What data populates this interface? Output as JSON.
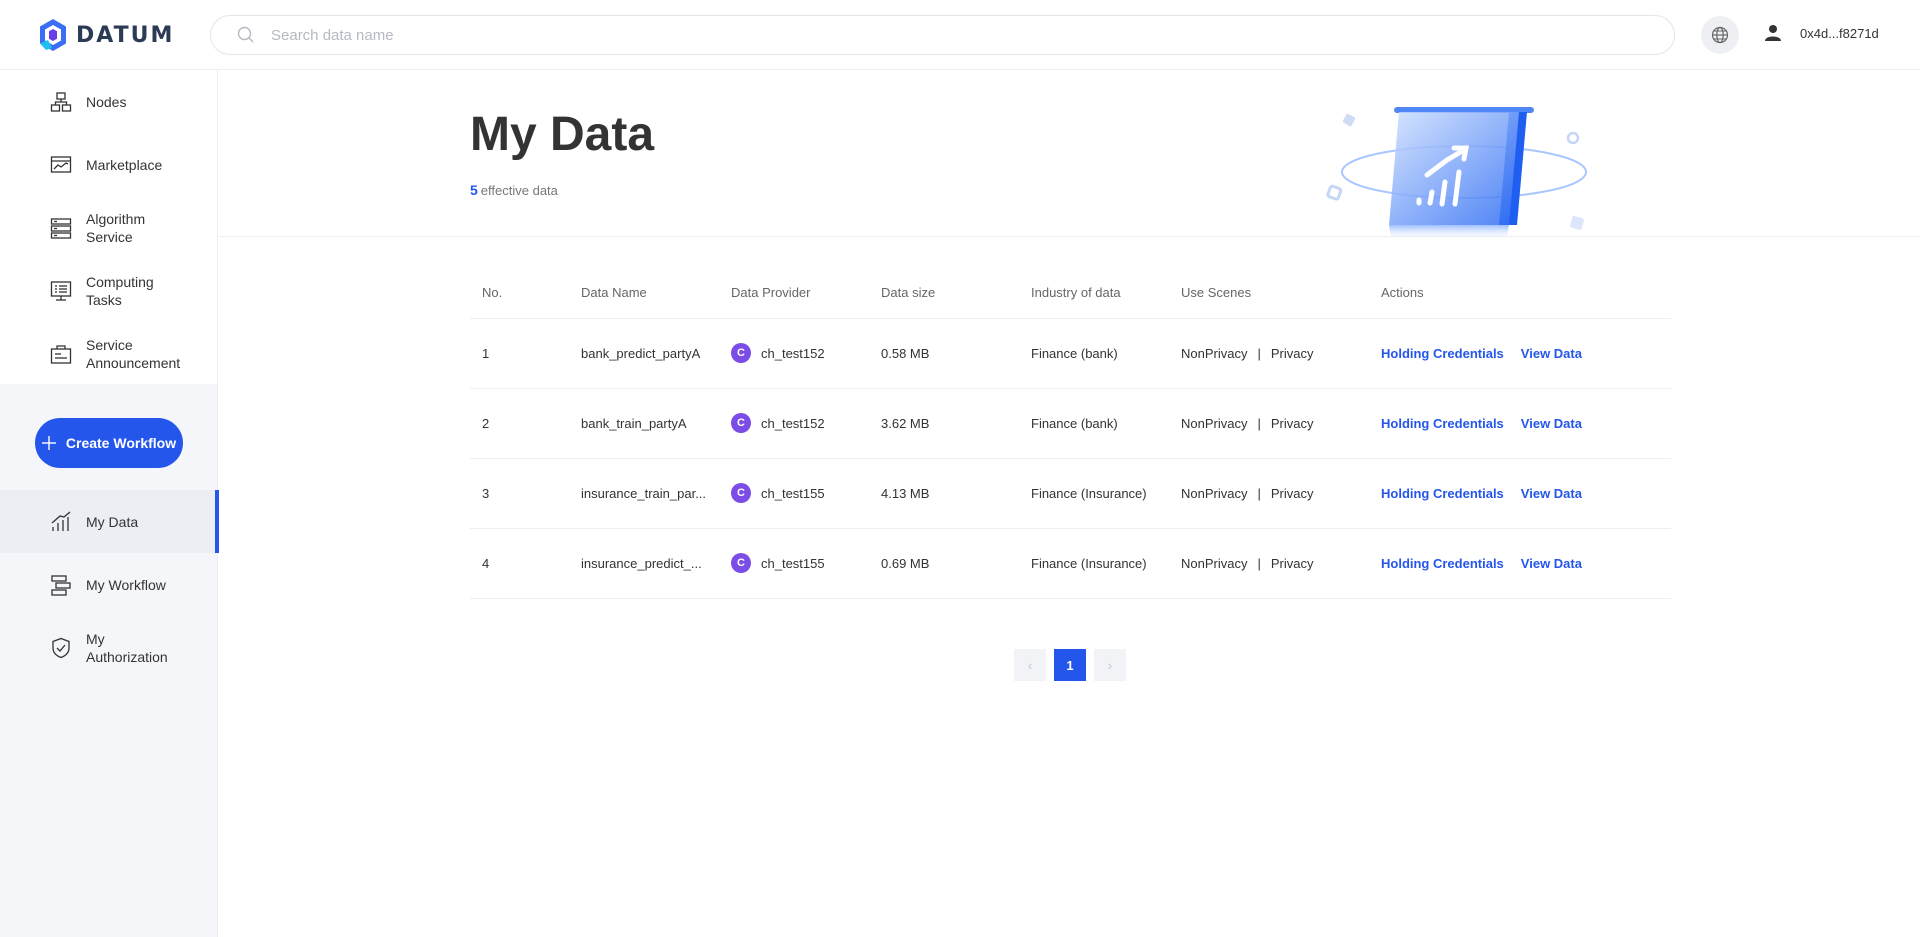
{
  "app": {
    "name": "DATUM"
  },
  "search": {
    "placeholder": "Search data name"
  },
  "user": {
    "address": "0x4d...f8271d"
  },
  "sidebar": {
    "top_items": [
      {
        "label": "Nodes",
        "icon": "nodes-icon"
      },
      {
        "label": "Marketplace",
        "icon": "marketplace-icon"
      },
      {
        "label": "Algorithm Service",
        "icon": "algorithm-icon"
      },
      {
        "label": "Computing Tasks",
        "icon": "computing-icon"
      },
      {
        "label": "Service Announcement",
        "icon": "announcement-icon"
      }
    ],
    "create_label": "Create Workflow",
    "bottom_items": [
      {
        "label": "My Data",
        "icon": "my-data-icon",
        "active": true
      },
      {
        "label": "My Workflow",
        "icon": "workflow-icon",
        "active": false
      },
      {
        "label": "My Authorization",
        "icon": "authorization-icon",
        "active": false
      }
    ]
  },
  "page": {
    "title": "My Data",
    "count": "5",
    "count_suffix": "effective data"
  },
  "table": {
    "headers": [
      "No.",
      "Data Name",
      "Data Provider",
      "Data size",
      "Industry of data",
      "Use Scenes",
      "Actions"
    ],
    "rows": [
      {
        "no": "1",
        "name": "bank_predict_partyA",
        "avatar": "C",
        "provider": "ch_test152",
        "size": "0.58 MB",
        "industry": "Finance (bank)",
        "scene1": "NonPrivacy",
        "sep": "|",
        "scene2": "Privacy",
        "action1": "Holding Credentials",
        "action2": "View Data"
      },
      {
        "no": "2",
        "name": "bank_train_partyA",
        "avatar": "C",
        "provider": "ch_test152",
        "size": "3.62 MB",
        "industry": "Finance (bank)",
        "scene1": "NonPrivacy",
        "sep": "|",
        "scene2": "Privacy",
        "action1": "Holding Credentials",
        "action2": "View Data"
      },
      {
        "no": "3",
        "name": "insurance_train_par...",
        "avatar": "C",
        "provider": "ch_test155",
        "size": "4.13 MB",
        "industry": "Finance (Insurance)",
        "scene1": "NonPrivacy",
        "sep": "|",
        "scene2": "Privacy",
        "action1": "Holding Credentials",
        "action2": "View Data"
      },
      {
        "no": "4",
        "name": "insurance_predict_...",
        "avatar": "C",
        "provider": "ch_test155",
        "size": "0.69 MB",
        "industry": "Finance (Insurance)",
        "scene1": "NonPrivacy",
        "sep": "|",
        "scene2": "Privacy",
        "action1": "Holding Credentials",
        "action2": "View Data"
      }
    ]
  },
  "pagination": {
    "prev": "‹",
    "current": "1",
    "next": "›"
  },
  "colors": {
    "accent": "#2456ec",
    "avatar": "#7b4ce6"
  }
}
